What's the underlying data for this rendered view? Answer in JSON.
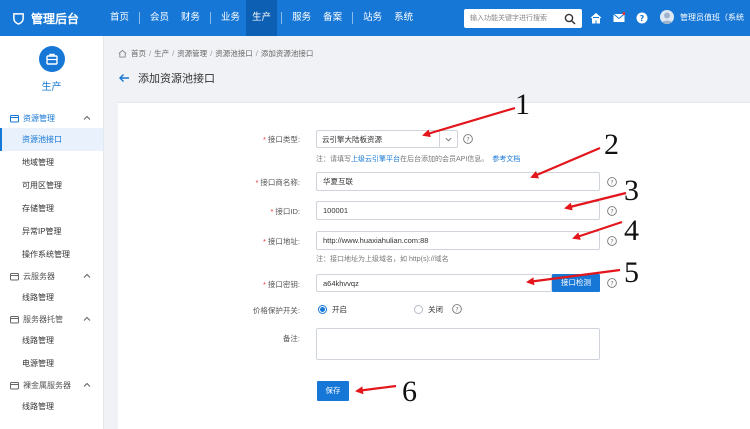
{
  "header": {
    "logo": "管理后台",
    "nav": [
      {
        "label": "首页",
        "active": false,
        "sep_after": true
      },
      {
        "label": "会员",
        "active": false,
        "sep_after": false
      },
      {
        "label": "财务",
        "active": false,
        "sep_after": true
      },
      {
        "label": "业务",
        "active": false,
        "sep_after": false
      },
      {
        "label": "生产",
        "active": true,
        "sep_after": true
      },
      {
        "label": "服务",
        "active": false,
        "sep_after": false
      },
      {
        "label": "备案",
        "active": false,
        "sep_after": true
      },
      {
        "label": "站务",
        "active": false,
        "sep_after": false
      },
      {
        "label": "系统",
        "active": false,
        "sep_after": false
      }
    ],
    "search_placeholder": "输入功能关键字进行搜索",
    "user": "管理员值班（系统"
  },
  "sidebar": {
    "title": "生产",
    "groups": [
      {
        "label": "资源管理",
        "highlight": true,
        "items": [
          {
            "label": "资源池接口",
            "active": true
          },
          {
            "label": "地域管理",
            "active": false
          },
          {
            "label": "可用区管理",
            "active": false
          },
          {
            "label": "存储管理",
            "active": false
          },
          {
            "label": "异常IP管理",
            "active": false
          },
          {
            "label": "操作系统管理",
            "active": false
          }
        ]
      },
      {
        "label": "云服务器",
        "highlight": false,
        "items": [
          {
            "label": "线路管理",
            "active": false
          }
        ]
      },
      {
        "label": "服务器托管",
        "highlight": false,
        "items": [
          {
            "label": "线路管理",
            "active": false
          },
          {
            "label": "电源管理",
            "active": false
          }
        ]
      },
      {
        "label": "裸金属服务器",
        "highlight": false,
        "items": [
          {
            "label": "线路管理",
            "active": false
          }
        ]
      }
    ]
  },
  "breadcrumb": [
    "首页",
    "生产",
    "资源管理",
    "资源池接口",
    "添加资源池接口"
  ],
  "page_title": "添加资源池接口",
  "form": {
    "type": {
      "label": "接口类型:",
      "value": "云引擎大陆板资源"
    },
    "type_hint": {
      "prefix": "注：请填写",
      "link1": "上级云引擎平台",
      "middle": "在后台添加的会员API信息。",
      "link2": "参考文档"
    },
    "vendor": {
      "label": "接口商名称:",
      "value": "华夏互联"
    },
    "id": {
      "label": "接口ID:",
      "value": "100001"
    },
    "url": {
      "label": "接口地址:",
      "value": "http://www.huaxiahulian.com:88"
    },
    "url_hint": "注：接口地址为上级域名，如 http(s)://域名",
    "key": {
      "label": "接口密钥:",
      "value": "a64khvvqz"
    },
    "check_button": "接口检测",
    "price_protect": {
      "label": "价格保护开关:",
      "on": "开启",
      "off": "关闭"
    },
    "remark": {
      "label": "备注:",
      "value": ""
    },
    "save_button": "保存"
  },
  "annotations": [
    "1",
    "2",
    "3",
    "4",
    "5",
    "6"
  ],
  "colors": {
    "primary": "#1677d6",
    "required": "#e0342f",
    "annotation": "#e3161c"
  }
}
